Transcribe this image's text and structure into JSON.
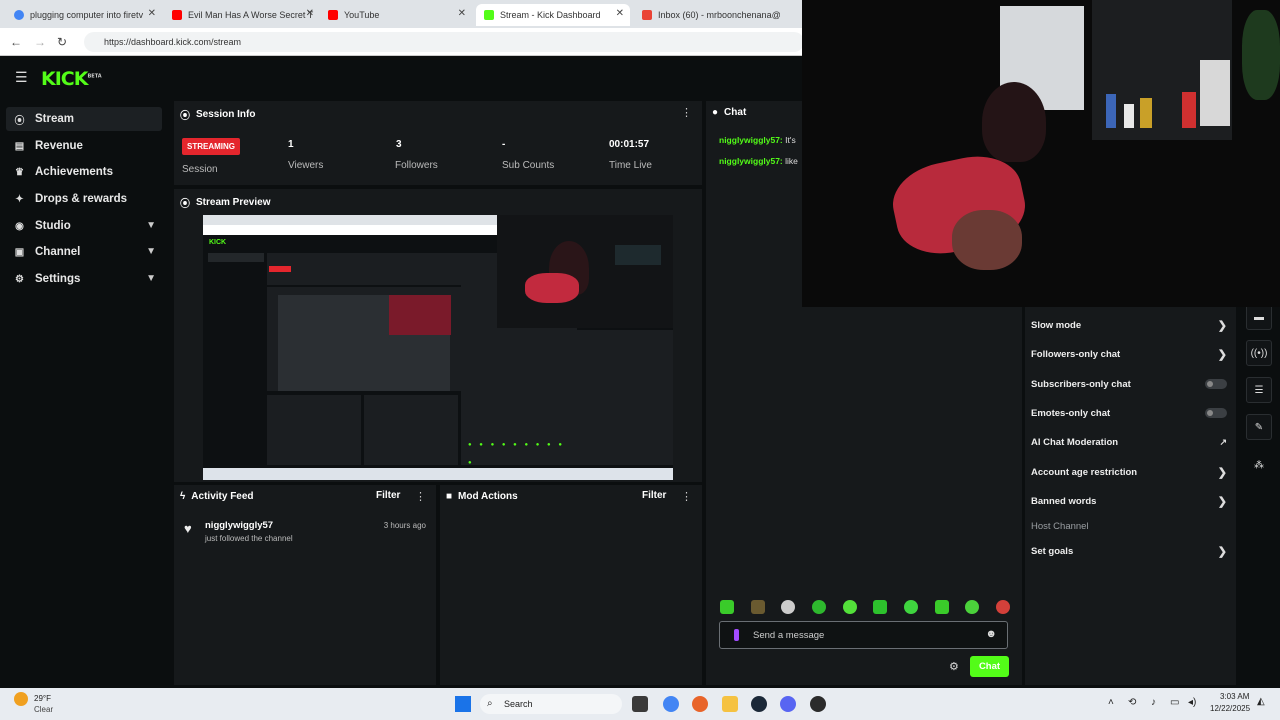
{
  "browser": {
    "tabs": [
      {
        "title": "plugging computer into firetv",
        "fav_color": "#4285f4"
      },
      {
        "title": "Evil Man Has A Worse Secret T",
        "fav_color": "#ff0000"
      },
      {
        "title": "YouTube",
        "fav_color": "#ff0000"
      },
      {
        "title": "Stream - Kick Dashboard",
        "fav_color": "#53fc18"
      },
      {
        "title": "Inbox (60) - mrboonchenana@",
        "fav_color": "#ea4335"
      }
    ],
    "url": "https://dashboard.kick.com/stream"
  },
  "logo": {
    "text": "KICK",
    "sup": "BETA"
  },
  "sidebar": {
    "items": [
      {
        "label": "Stream",
        "icon": "broadcast-icon"
      },
      {
        "label": "Revenue",
        "icon": "revenue-icon"
      },
      {
        "label": "Achievements",
        "icon": "trophy-icon"
      },
      {
        "label": "Drops & rewards",
        "icon": "gift-icon"
      },
      {
        "label": "Studio",
        "icon": "studio-icon"
      },
      {
        "label": "Channel",
        "icon": "channel-icon"
      },
      {
        "label": "Settings",
        "icon": "gear-icon"
      }
    ]
  },
  "session": {
    "title": "Session Info",
    "status": "STREAMING",
    "session_label": "Session",
    "viewers_value": "1",
    "viewers_label": "Viewers",
    "followers_value": "3",
    "followers_label": "Followers",
    "subs_value": "-",
    "subs_label": "Sub Counts",
    "time_value": "00:01:57",
    "time_label": "Time Live"
  },
  "preview": {
    "title": "Stream Preview"
  },
  "activity": {
    "title": "Activity Feed",
    "filter": "Filter",
    "item_user": "nigglywiggly57",
    "item_text": "just followed the channel",
    "item_time": "3 hours ago"
  },
  "mod": {
    "title": "Mod Actions",
    "filter": "Filter"
  },
  "chat": {
    "title": "Chat",
    "messages": [
      {
        "user": "nigglywiggly57:",
        "text": "It's"
      },
      {
        "user": "nigglywiggly57:",
        "text": "like"
      }
    ],
    "placeholder": "Send a message",
    "send_label": "Chat"
  },
  "chat_settings": {
    "items": [
      {
        "label": "Slow mode",
        "control": "chevron"
      },
      {
        "label": "Followers-only chat",
        "control": "chevron"
      },
      {
        "label": "Subscribers-only chat",
        "control": "toggle"
      },
      {
        "label": "Emotes-only chat",
        "control": "toggle"
      },
      {
        "label": "AI Chat Moderation",
        "control": "external"
      },
      {
        "label": "Account age restriction",
        "control": "chevron"
      },
      {
        "label": "Banned words",
        "control": "chevron"
      },
      {
        "label": "Host Channel",
        "control": "none"
      },
      {
        "label": "Set goals",
        "control": "chevron"
      }
    ]
  },
  "taskbar": {
    "weather_temp": "29°F",
    "weather_text": "Clear",
    "search_label": "Search",
    "time": "3:03 AM",
    "date": "12/22/2025"
  },
  "colors": {
    "accent": "#53fc18",
    "live": "#e4262d",
    "panel": "#16191b",
    "bg": "#0b0e0f"
  }
}
